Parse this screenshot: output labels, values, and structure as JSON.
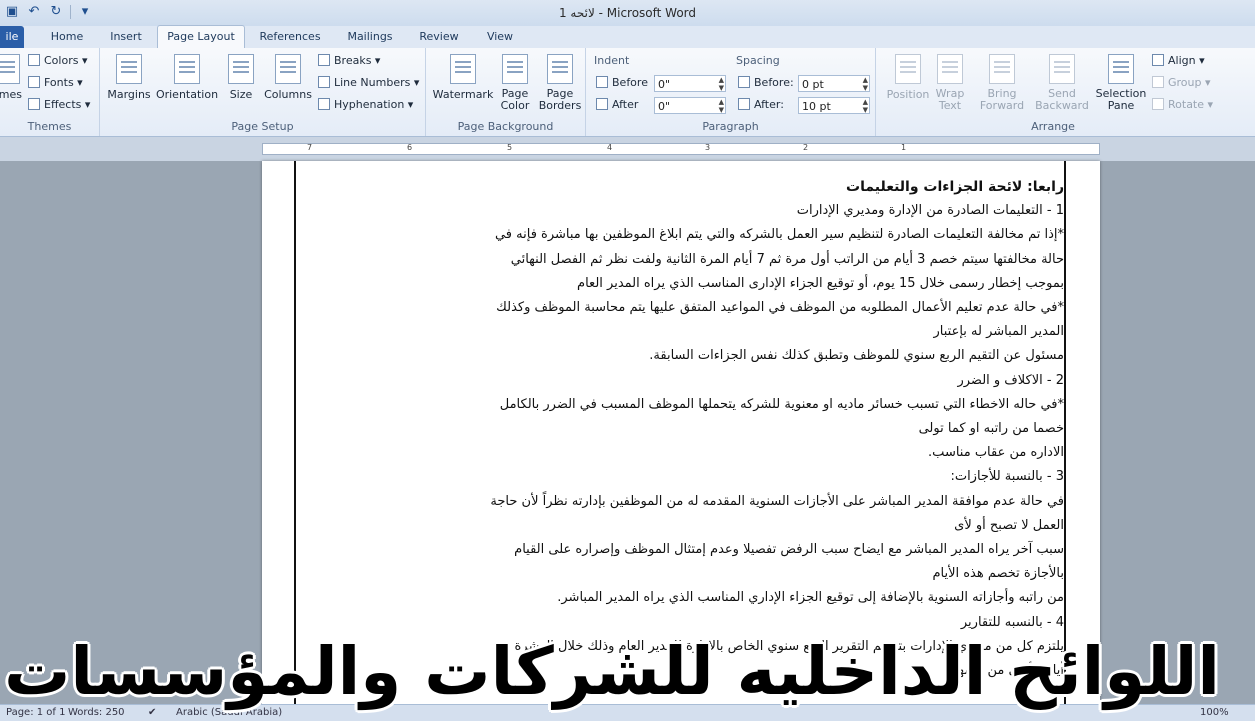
{
  "window": {
    "title": "لائحه 1  -  Microsoft Word"
  },
  "tabs": [
    "ile",
    "Home",
    "Insert",
    "Page Layout",
    "References",
    "Mailings",
    "Review",
    "View"
  ],
  "ribbon": {
    "themes": {
      "btn": "emes",
      "colors": "Colors",
      "fonts": "Fonts",
      "effects": "Effects",
      "label": "Themes"
    },
    "page_setup": {
      "margins": "Margins",
      "orientation": "Orientation",
      "size": "Size",
      "columns": "Columns",
      "breaks": "Breaks",
      "line_numbers": "Line Numbers",
      "hyphenation": "Hyphenation",
      "label": "Page Setup"
    },
    "page_background": {
      "watermark": "Watermark",
      "page_color_1": "Page",
      "page_color_2": "Color",
      "page_borders_1": "Page",
      "page_borders_2": "Borders",
      "label": "Page Background"
    },
    "paragraph": {
      "indent": "Indent",
      "before": "Before",
      "before_value": "0\"",
      "after": "After",
      "after_value": "0\"",
      "spacing": "Spacing",
      "sp_before": "Before:",
      "sp_before_value": "0 pt",
      "sp_after": "After:",
      "sp_after_value": "10 pt",
      "label": "Paragraph"
    },
    "arrange": {
      "position": "Position",
      "wrap_1": "Wrap",
      "wrap_2": "Text",
      "bring_1": "Bring",
      "bring_2": "Forward",
      "send_1": "Send",
      "send_2": "Backward",
      "selection_1": "Selection",
      "selection_2": "Pane",
      "align": "Align",
      "group": "Group",
      "rotate": "Rotate",
      "label": "Arrange"
    }
  },
  "ruler": {
    "numbers": [
      "7",
      "6",
      "5",
      "4",
      "3",
      "2",
      "1"
    ]
  },
  "document": {
    "lines": [
      "رابعا: لائحة الجزاءات والتعليمات",
      "1 -  التعليمات الصادرة من الإدارة ومديري الإدارات",
      "*إذا تم مخالفة التعليمات الصادرة لتنظيم سير العمل بالشركه والتي يتم ابلاغ الموظفين بها مباشرة فإنه في",
      "حالة مخالفتها سيتم خصم 3  أيام من الراتب أول مرة ثم 7 أيام المرة الثانية ولفت نظر ثم الفصل النهائي",
      "بموجب إخطار رسمى خلال 15 يوم، أو توقيع الجزاء الإدارى المناسب الذي يراه المدير العام",
      "*في حالة عدم تعليم الأعمال المطلوبه من الموظف في المواعيد المتفق عليها يتم محاسبة الموظف وكذلك",
      "المدير المباشر له بإعتبار",
      "مسئول عن التقيم الربع سنوي للموظف وتطبق كذلك نفس الجزاءات السابقة.",
      "2 - الاكلاف و الضرر",
      "*في حاله الاخطاء التي تسبب خسائر  ماديه او  معنوية للشركه يتحملها الموظف المسبب في الضرر  بالكامل",
      "خصما من راتبه او كما تولى",
      "الاداره من عقاب مناسب.",
      "3 - بالنسبة للأجازات:",
      "في حالة عدم موافقة المدير المباشر على الأجازات السنوية المقدمه له من الموظفين بإدارته نظراً لأن حاجة",
      "العمل لا تصبح أو لأى",
      "سبب آخر يراه المدير المباشر مع ايضاح سبب الرفض تفصيلا وعدم إمتثال الموظف وإصراره على القيام",
      "بالأجازة تخصم هذه الأيام",
      "من راتبه وأجازاته السنوية بالإضافة إلى توقيع الجزاء الإداري المناسب الذي يراه المدير المباشر.",
      "4 - بالنسبه للتقارير",
      "يلتزم كل من مديري الإدارات بتقديم التقرير الربع سنوي الخاص بالإدارة للمدير العام وذلك خلال العشرة",
      "أيام الأولى من الشهر"
    ]
  },
  "status": {
    "page": "Page: 1 of 1",
    "words": "Words: 250",
    "lang": "Arabic (Saudi Arabia)",
    "zoom": "100%"
  },
  "caption": "اللوائح الداخليه للشركات والمؤسسات"
}
